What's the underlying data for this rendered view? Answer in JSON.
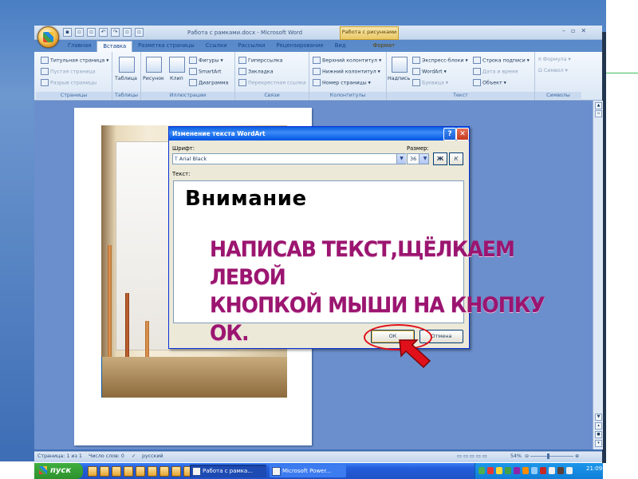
{
  "window": {
    "title": "Работа с рамками.docx - Microsoft Word",
    "context_tab_header": "Работа с рисунками",
    "controls": [
      "–",
      "▫",
      "✕"
    ]
  },
  "tabs": [
    {
      "label": "Главная"
    },
    {
      "label": "Вставка",
      "active": true
    },
    {
      "label": "Разметка страницы"
    },
    {
      "label": "Ссылки"
    },
    {
      "label": "Рассылки"
    },
    {
      "label": "Рецензирование"
    },
    {
      "label": "Вид"
    },
    {
      "label": "Формат",
      "context": true
    }
  ],
  "ribbon": {
    "pages": {
      "label": "Страницы",
      "items": [
        "Титульная страница",
        "Пустая страница",
        "Разрыв страницы"
      ]
    },
    "tables": {
      "label": "Таблицы",
      "items": [
        "Таблица"
      ]
    },
    "illustrations": {
      "label": "Иллюстрации",
      "items": [
        "Рисунок",
        "Клип",
        "Фигуры",
        "SmartArt",
        "Диаграмма"
      ]
    },
    "links": {
      "label": "Связи",
      "items": [
        "Гиперссылка",
        "Закладка",
        "Перекрестная ссылка"
      ]
    },
    "header_footer": {
      "label": "Колонтитулы",
      "items": [
        "Верхний колонтитул",
        "Нижний колонтитул",
        "Номер страницы"
      ]
    },
    "text": {
      "label": "Текст",
      "items": [
        "Надпись",
        "Экспресс-блоки",
        "WordArt",
        "Буквица",
        "Строка подписи",
        "Дата и время",
        "Объект"
      ]
    },
    "symbols": {
      "label": "Символы",
      "items": [
        "Формула",
        "Символ"
      ]
    }
  },
  "dialog": {
    "title": "Изменение текста WordArt",
    "font_label": "Шрифт:",
    "font_value": "Arial Black",
    "size_label": "Размер:",
    "size_value": "36",
    "bold_label": "Ж",
    "italic_label": "К",
    "text_label": "Текст:",
    "text_value": "Внимание",
    "ok_label": "ОК",
    "cancel_label": "Отмена"
  },
  "instruction": {
    "line1": "Написав текст,щёлкаем  левой",
    "line2": "кнопкой мыши на кнопку ОК."
  },
  "statusbar": {
    "page": "Страница: 1 из 1",
    "words": "Число слов: 0",
    "language": "русский",
    "zoom": "54%"
  },
  "taskbar": {
    "start_label": "пуск",
    "tasks": [
      "Работа с рамка...",
      "Microsoft Power..."
    ],
    "clock": "21:09"
  },
  "colors": {
    "instruction_text": "#9b1570",
    "annotation_red": "#e0101a",
    "dialog_title_bar": "#0a5de0"
  }
}
